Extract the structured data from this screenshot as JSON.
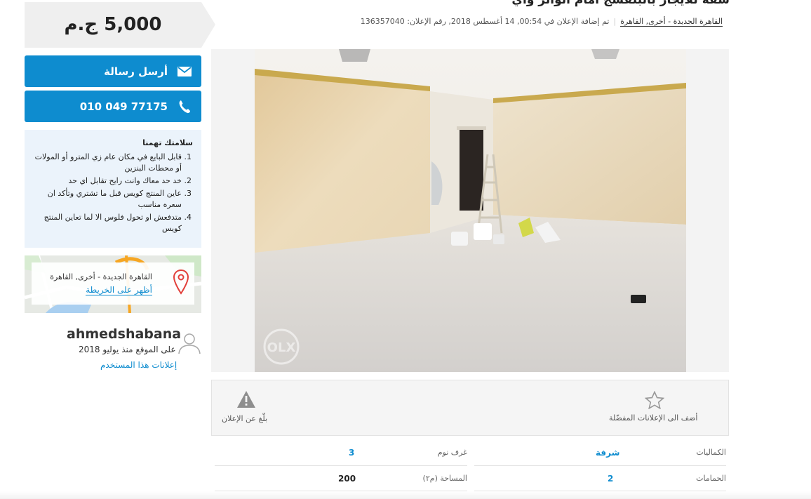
{
  "ad": {
    "title": "شقة للايجار بالبنفسج امام الوائر واي",
    "location": "القاهرة الجديدة - أخرى, القاهرة",
    "added_text": "تم إضافة الإعلان في 00:54, 14 أغسطس 2018, رقم الإعلان: 136357040"
  },
  "price": "5,000 ج.م",
  "buttons": {
    "message": "أرسل رسالة",
    "phone": "010 049 77175"
  },
  "safety": {
    "heading": "سلامتك تهمنا",
    "tips": [
      "قابل البايع في مكان عام زي المترو أو المولات أو محطات البنزين",
      "خد حد معاك وانت رايح تقابل اي حد",
      "عاين المنتج كويس قبل ما تشتري وتأكد ان سعره مناسب",
      "متدفعش او تحول فلوس الا لما تعاين المنتج كويس"
    ]
  },
  "map": {
    "location": "القاهرة الجديدة - أخرى, القاهرة",
    "link": "أظهر على الخريطة"
  },
  "user": {
    "name": "ahmedshabana",
    "since": "على الموقع منذ يوليو 2018",
    "ads_link": "إعلانات هذا المستخدم"
  },
  "photo": {
    "watermark": "OLX"
  },
  "actions": {
    "report": "بلّغ عن الإعلان",
    "favorite": "أضف الى الإعلانات المفضّلة"
  },
  "params": [
    {
      "label": "الكماليات",
      "value": "شرفة",
      "link": true
    },
    {
      "label": "غرف نوم",
      "value": "3",
      "link": true
    },
    {
      "label": "الحمامات",
      "value": "2",
      "link": true
    },
    {
      "label": "المساحة (م٢)",
      "value": "200",
      "link": false
    }
  ],
  "colors": {
    "accent": "#0e8ccf",
    "safety_bg": "#ebf3fb",
    "price_bg": "#efefef"
  }
}
